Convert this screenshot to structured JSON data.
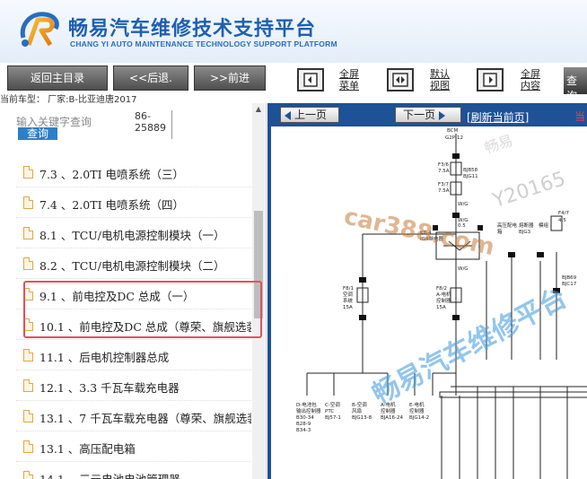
{
  "header": {
    "title_cn": "畅易汽车维修技术支持平台",
    "title_en": "CHANG YI AUTO MAINTENANCE TECHNOLOGY SUPPORT PLATFORM"
  },
  "toolbar": {
    "back_main": "返回主目录",
    "back": "<<后退.",
    "forward": ">>前进",
    "fullscreen_menu": [
      "全屏",
      "菜单"
    ],
    "default_view": [
      "默认",
      "视图"
    ],
    "fullscreen_content": [
      "全屏",
      "内容"
    ],
    "search": "查询"
  },
  "car_info": "当前车型： 厂家:B-比亚迪唐2017",
  "search": {
    "placeholder": "输入关键字查询",
    "button": "查询",
    "count_line1": "86-",
    "count_line2": "25889"
  },
  "tree": [
    {
      "label": "7.3 、2.0TI 电喷系统（三）"
    },
    {
      "label": "7.4 、2.0TI 电喷系统（四）"
    },
    {
      "label": "8.1 、TCU/电机电源控制模块（一）"
    },
    {
      "label": "8.2 、TCU/电机电源控制模块（二）"
    },
    {
      "label": "9.1 、前电控及DC 总成（一）"
    },
    {
      "label": "10.1 、前电控及DC 总成（尊荣、旗舰选装"
    },
    {
      "label": "11.1 、后电机控制器总成"
    },
    {
      "label": "12.1 、3.3 千瓦车载充电器"
    },
    {
      "label": "13.1 、7 千瓦车载充电器（尊荣、旗舰选装"
    },
    {
      "label": "13.1 、高压配电箱"
    },
    {
      "label": "14.1 、三元电池电池管理器"
    }
  ],
  "viewer": {
    "prev_page": "上一页",
    "next_page": "下一页",
    "refresh": "[刷新当前页]",
    "current": "当"
  },
  "diagram": {
    "labels_top": [
      "BCM",
      "G2P-12",
      "F3/6",
      "7.5A",
      "F3/7",
      "7.5A",
      "BJB58",
      "BJG11",
      "W/G",
      "W/G",
      "0.5",
      "K8-4",
      "IG4继电器",
      "W/G"
    ],
    "labels_mid": [
      "高压配电",
      "箱",
      "熔断器",
      "BJG3",
      "模组",
      "F4/7",
      "4.5",
      "F8/1",
      "空调",
      "系统",
      "15A",
      "F8/2",
      "A-电机",
      "控制器",
      "15A",
      "BJB69",
      "BJC17"
    ],
    "labels_bot": [
      "D-电池包",
      "输出控制器",
      "B30-34",
      "B28-9",
      "B34-3",
      "C-空调",
      "PTC",
      "BJ57-1",
      "B-空调",
      "风扇",
      "BJG13-8",
      "A-电机",
      "控制器",
      "BJA16-24",
      "E-电机",
      "控制器",
      "BJG14-2"
    ]
  },
  "watermarks": [
    "car388.com",
    "畅易汽车维修平台",
    "Y20165",
    "畅易"
  ]
}
